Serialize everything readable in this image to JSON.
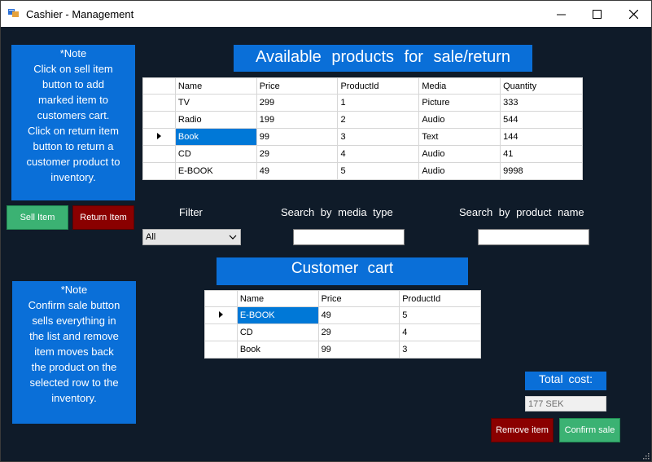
{
  "window": {
    "title": "Cashier - Management",
    "controls": {
      "minimize": "—",
      "maximize": "☐",
      "close": "✕"
    }
  },
  "note1": {
    "heading": "*Note",
    "lines": [
      "Click on sell item",
      "button to add",
      "marked item to",
      "customers cart.",
      "Click on return item",
      "button to return a",
      "customer product to",
      "inventory."
    ]
  },
  "note2": {
    "heading": "*Note",
    "lines": [
      "Confirm sale button",
      "sells everything in",
      "the list and remove",
      "item moves back",
      "the product on the",
      "selected row to the",
      "inventory."
    ]
  },
  "buttons": {
    "sell": "Sell Item",
    "return": "Return Item",
    "remove": "Remove item",
    "confirm": "Confirm sale"
  },
  "products": {
    "heading": "Available products for sale/return",
    "columns": [
      "Name",
      "Price",
      "ProductId",
      "Media",
      "Quantity"
    ],
    "rows": [
      [
        "TV",
        "299",
        "1",
        "Picture",
        "333"
      ],
      [
        "Radio",
        "199",
        "2",
        "Audio",
        "544"
      ],
      [
        "Book",
        "99",
        "3",
        "Text",
        "144"
      ],
      [
        "CD",
        "29",
        "4",
        "Audio",
        "41"
      ],
      [
        "E-BOOK",
        "49",
        "5",
        "Audio",
        "9998"
      ]
    ],
    "selected_row": 2
  },
  "filters": {
    "filter_label": "Filter",
    "filter_value": "All",
    "media_label": "Search by media type",
    "media_value": "",
    "name_label": "Search by product name",
    "name_value": ""
  },
  "cart": {
    "heading": "Customer cart",
    "columns": [
      "Name",
      "Price",
      "ProductId"
    ],
    "rows": [
      [
        "E-BOOK",
        "49",
        "5"
      ],
      [
        "CD",
        "29",
        "4"
      ],
      [
        "Book",
        "99",
        "3"
      ]
    ],
    "selected_row": 0
  },
  "total": {
    "label": "Total cost:",
    "value": "177 SEK"
  },
  "colors": {
    "background": "#0f1b29",
    "panel_blue": "#0a6fd8",
    "green_button": "#3bb273",
    "red_button": "#8a0000",
    "selection": "#0078d7"
  }
}
